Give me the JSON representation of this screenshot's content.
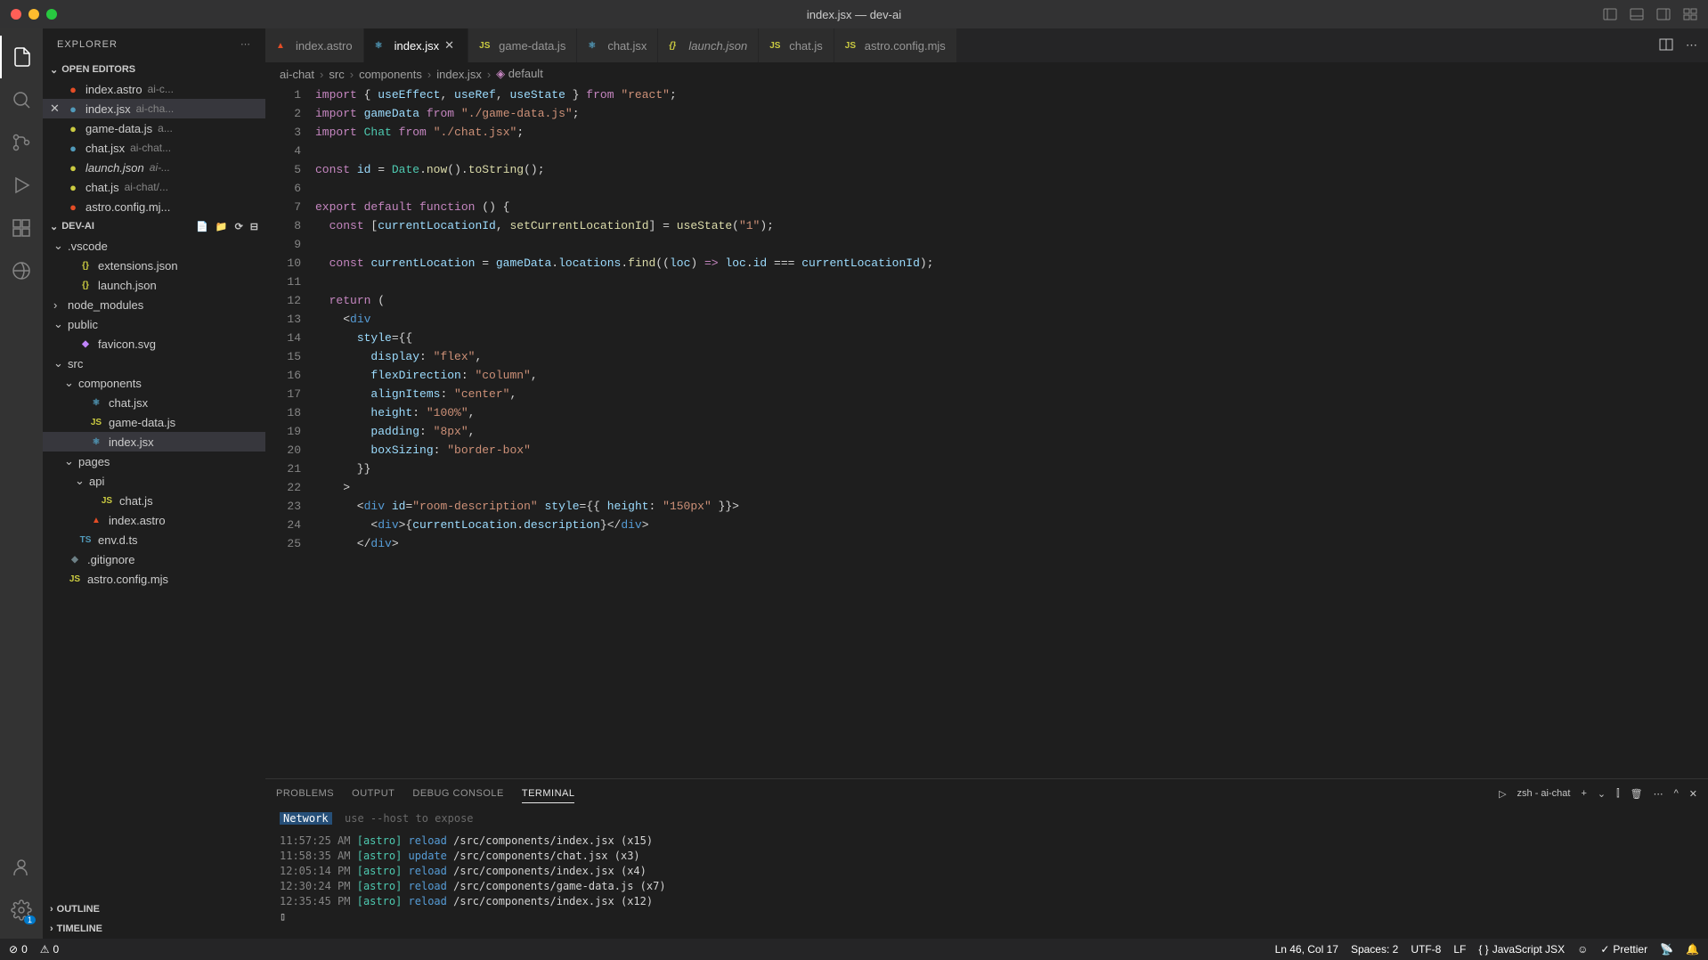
{
  "title": "index.jsx — dev-ai",
  "sidebar": {
    "title": "EXPLORER",
    "openEditorsLabel": "OPEN EDITORS",
    "projectLabel": "DEV-AI",
    "outlineLabel": "OUTLINE",
    "timelineLabel": "TIMELINE",
    "openEditors": [
      {
        "name": "index.astro",
        "path": "ai-c...",
        "iconColor": "#e44d26",
        "active": false
      },
      {
        "name": "index.jsx",
        "path": "ai-cha...",
        "iconColor": "#519aba",
        "active": true
      },
      {
        "name": "game-data.js",
        "path": "a...",
        "iconColor": "#cbcb41",
        "active": false
      },
      {
        "name": "chat.jsx",
        "path": "ai-chat...",
        "iconColor": "#519aba",
        "active": false
      },
      {
        "name": "launch.json",
        "path": "ai-...",
        "iconColor": "#cbcb41",
        "italic": true,
        "active": false
      },
      {
        "name": "chat.js",
        "path": "ai-chat/...",
        "iconColor": "#cbcb41",
        "active": false
      },
      {
        "name": "astro.config.mj...",
        "path": "",
        "iconColor": "#e44d26",
        "active": false
      }
    ],
    "tree": [
      {
        "depth": 0,
        "chev": "v",
        "name": ".vscode",
        "folder": true
      },
      {
        "depth": 1,
        "name": "extensions.json",
        "icon": "{}",
        "iconColor": "#cbcb41"
      },
      {
        "depth": 1,
        "name": "launch.json",
        "icon": "{}",
        "iconColor": "#cbcb41"
      },
      {
        "depth": 0,
        "chev": ">",
        "name": "node_modules",
        "folder": true
      },
      {
        "depth": 0,
        "chev": "v",
        "name": "public",
        "folder": true
      },
      {
        "depth": 1,
        "name": "favicon.svg",
        "icon": "◆",
        "iconColor": "#c084fc"
      },
      {
        "depth": 0,
        "chev": "v",
        "name": "src",
        "folder": true
      },
      {
        "depth": 1,
        "chev": "v",
        "name": "components",
        "folder": true
      },
      {
        "depth": 2,
        "name": "chat.jsx",
        "icon": "⚛",
        "iconColor": "#519aba"
      },
      {
        "depth": 2,
        "name": "game-data.js",
        "icon": "JS",
        "iconColor": "#cbcb41"
      },
      {
        "depth": 2,
        "name": "index.jsx",
        "icon": "⚛",
        "iconColor": "#519aba",
        "active": true
      },
      {
        "depth": 1,
        "chev": "v",
        "name": "pages",
        "folder": true
      },
      {
        "depth": 2,
        "chev": "v",
        "name": "api",
        "folder": true
      },
      {
        "depth": 3,
        "name": "chat.js",
        "icon": "JS",
        "iconColor": "#cbcb41"
      },
      {
        "depth": 2,
        "name": "index.astro",
        "icon": "▲",
        "iconColor": "#e44d26"
      },
      {
        "depth": 1,
        "name": "env.d.ts",
        "icon": "TS",
        "iconColor": "#519aba"
      },
      {
        "depth": 0,
        "name": ".gitignore",
        "icon": "◆",
        "iconColor": "#6d8086"
      },
      {
        "depth": 0,
        "name": "astro.config.mjs",
        "icon": "JS",
        "iconColor": "#cbcb41"
      }
    ]
  },
  "tabs": [
    {
      "name": "index.astro",
      "icon": "▲",
      "iconColor": "#e44d26"
    },
    {
      "name": "index.jsx",
      "icon": "⚛",
      "iconColor": "#519aba",
      "active": true
    },
    {
      "name": "game-data.js",
      "icon": "JS",
      "iconColor": "#cbcb41"
    },
    {
      "name": "chat.jsx",
      "icon": "⚛",
      "iconColor": "#519aba"
    },
    {
      "name": "launch.json",
      "icon": "{}",
      "iconColor": "#cbcb41",
      "italic": true
    },
    {
      "name": "chat.js",
      "icon": "JS",
      "iconColor": "#cbcb41"
    },
    {
      "name": "astro.config.mjs",
      "icon": "JS",
      "iconColor": "#cbcb41"
    }
  ],
  "breadcrumb": [
    "ai-chat",
    "src",
    "components",
    "index.jsx",
    "default"
  ],
  "code": [
    [
      [
        "kw",
        "import"
      ],
      [
        "pn",
        " { "
      ],
      [
        "var",
        "useEffect"
      ],
      [
        "pn",
        ", "
      ],
      [
        "var",
        "useRef"
      ],
      [
        "pn",
        ", "
      ],
      [
        "var",
        "useState"
      ],
      [
        "pn",
        " } "
      ],
      [
        "kw",
        "from"
      ],
      [
        "pn",
        " "
      ],
      [
        "str",
        "\"react\""
      ],
      [
        "pn",
        ";"
      ]
    ],
    [
      [
        "kw",
        "import"
      ],
      [
        "pn",
        " "
      ],
      [
        "var",
        "gameData"
      ],
      [
        "pn",
        " "
      ],
      [
        "kw",
        "from"
      ],
      [
        "pn",
        " "
      ],
      [
        "str",
        "\"./game-data.js\""
      ],
      [
        "pn",
        ";"
      ]
    ],
    [
      [
        "kw",
        "import"
      ],
      [
        "pn",
        " "
      ],
      [
        "comp",
        "Chat"
      ],
      [
        "pn",
        " "
      ],
      [
        "kw",
        "from"
      ],
      [
        "pn",
        " "
      ],
      [
        "str",
        "\"./chat.jsx\""
      ],
      [
        "pn",
        ";"
      ]
    ],
    [],
    [
      [
        "kw",
        "const"
      ],
      [
        "pn",
        " "
      ],
      [
        "var",
        "id"
      ],
      [
        "pn",
        " = "
      ],
      [
        "type",
        "Date"
      ],
      [
        "pn",
        "."
      ],
      [
        "fn",
        "now"
      ],
      [
        "pn",
        "()."
      ],
      [
        "fn",
        "toString"
      ],
      [
        "pn",
        "();"
      ]
    ],
    [],
    [
      [
        "kw",
        "export"
      ],
      [
        "pn",
        " "
      ],
      [
        "kw",
        "default"
      ],
      [
        "pn",
        " "
      ],
      [
        "kw",
        "function"
      ],
      [
        "pn",
        " () {"
      ]
    ],
    [
      [
        "pn",
        "  "
      ],
      [
        "kw",
        "const"
      ],
      [
        "pn",
        " ["
      ],
      [
        "var",
        "currentLocationId"
      ],
      [
        "pn",
        ", "
      ],
      [
        "fn",
        "setCurrentLocationId"
      ],
      [
        "pn",
        "] = "
      ],
      [
        "fn",
        "useState"
      ],
      [
        "pn",
        "("
      ],
      [
        "str",
        "\"1\""
      ],
      [
        "pn",
        ");"
      ]
    ],
    [],
    [
      [
        "pn",
        "  "
      ],
      [
        "kw",
        "const"
      ],
      [
        "pn",
        " "
      ],
      [
        "var",
        "currentLocation"
      ],
      [
        "pn",
        " = "
      ],
      [
        "var",
        "gameData"
      ],
      [
        "pn",
        "."
      ],
      [
        "var",
        "locations"
      ],
      [
        "pn",
        "."
      ],
      [
        "fn",
        "find"
      ],
      [
        "pn",
        "(("
      ],
      [
        "var",
        "loc"
      ],
      [
        "pn",
        ") "
      ],
      [
        "kw",
        "=>"
      ],
      [
        "pn",
        " "
      ],
      [
        "var",
        "loc"
      ],
      [
        "pn",
        "."
      ],
      [
        "var",
        "id"
      ],
      [
        "pn",
        " === "
      ],
      [
        "var",
        "currentLocationId"
      ],
      [
        "pn",
        ");"
      ]
    ],
    [],
    [
      [
        "pn",
        "  "
      ],
      [
        "kw",
        "return"
      ],
      [
        "pn",
        " ("
      ]
    ],
    [
      [
        "pn",
        "    <"
      ],
      [
        "tag",
        "div"
      ]
    ],
    [
      [
        "pn",
        "      "
      ],
      [
        "attr",
        "style"
      ],
      [
        "pn",
        "={{"
      ]
    ],
    [
      [
        "pn",
        "        "
      ],
      [
        "prop",
        "display"
      ],
      [
        "pn",
        ": "
      ],
      [
        "str",
        "\"flex\""
      ],
      [
        "pn",
        ","
      ]
    ],
    [
      [
        "pn",
        "        "
      ],
      [
        "prop",
        "flexDirection"
      ],
      [
        "pn",
        ": "
      ],
      [
        "str",
        "\"column\""
      ],
      [
        "pn",
        ","
      ]
    ],
    [
      [
        "pn",
        "        "
      ],
      [
        "prop",
        "alignItems"
      ],
      [
        "pn",
        ": "
      ],
      [
        "str",
        "\"center\""
      ],
      [
        "pn",
        ","
      ]
    ],
    [
      [
        "pn",
        "        "
      ],
      [
        "prop",
        "height"
      ],
      [
        "pn",
        ": "
      ],
      [
        "str",
        "\"100%\""
      ],
      [
        "pn",
        ","
      ]
    ],
    [
      [
        "pn",
        "        "
      ],
      [
        "prop",
        "padding"
      ],
      [
        "pn",
        ": "
      ],
      [
        "str",
        "\"8px\""
      ],
      [
        "pn",
        ","
      ]
    ],
    [
      [
        "pn",
        "        "
      ],
      [
        "prop",
        "boxSizing"
      ],
      [
        "pn",
        ": "
      ],
      [
        "str",
        "\"border-box\""
      ]
    ],
    [
      [
        "pn",
        "      }}"
      ]
    ],
    [
      [
        "pn",
        "    >"
      ]
    ],
    [
      [
        "pn",
        "      <"
      ],
      [
        "tag",
        "div"
      ],
      [
        "pn",
        " "
      ],
      [
        "attr",
        "id"
      ],
      [
        "pn",
        "="
      ],
      [
        "str",
        "\"room-description\""
      ],
      [
        "pn",
        " "
      ],
      [
        "attr",
        "style"
      ],
      [
        "pn",
        "={{ "
      ],
      [
        "prop",
        "height"
      ],
      [
        "pn",
        ": "
      ],
      [
        "str",
        "\"150px\""
      ],
      [
        "pn",
        " }}>"
      ]
    ],
    [
      [
        "pn",
        "        <"
      ],
      [
        "tag",
        "div"
      ],
      [
        "pn",
        ">{"
      ],
      [
        "var",
        "currentLocation"
      ],
      [
        "pn",
        "."
      ],
      [
        "var",
        "description"
      ],
      [
        "pn",
        "}</"
      ],
      [
        "tag",
        "div"
      ],
      [
        "pn",
        ">"
      ]
    ],
    [
      [
        "pn",
        "      </"
      ],
      [
        "tag",
        "div"
      ],
      [
        "pn",
        ">"
      ]
    ]
  ],
  "panel": {
    "tabs": [
      "PROBLEMS",
      "OUTPUT",
      "DEBUG CONSOLE",
      "TERMINAL"
    ],
    "activeTab": 3,
    "shellLabel": "zsh - ai-chat",
    "networkLabel": "Network",
    "networkHint": "use --host to expose",
    "lines": [
      {
        "time": "11:57:25 AM",
        "tag": "[astro]",
        "action": "reload",
        "path": "/src/components/index.jsx (x15)"
      },
      {
        "time": "11:58:35 AM",
        "tag": "[astro]",
        "action": "update",
        "path": "/src/components/chat.jsx (x3)"
      },
      {
        "time": "12:05:14 PM",
        "tag": "[astro]",
        "action": "reload",
        "path": "/src/components/index.jsx (x4)"
      },
      {
        "time": "12:30:24 PM",
        "tag": "[astro]",
        "action": "reload",
        "path": "/src/components/game-data.js (x7)"
      },
      {
        "time": "12:35:45 PM",
        "tag": "[astro]",
        "action": "reload",
        "path": "/src/components/index.jsx (x12)"
      }
    ]
  },
  "status": {
    "errors": "0",
    "warnings": "0",
    "lineCol": "Ln 46, Col 17",
    "spaces": "Spaces: 2",
    "encoding": "UTF-8",
    "eol": "LF",
    "lang": "JavaScript JSX",
    "prettier": "Prettier"
  }
}
